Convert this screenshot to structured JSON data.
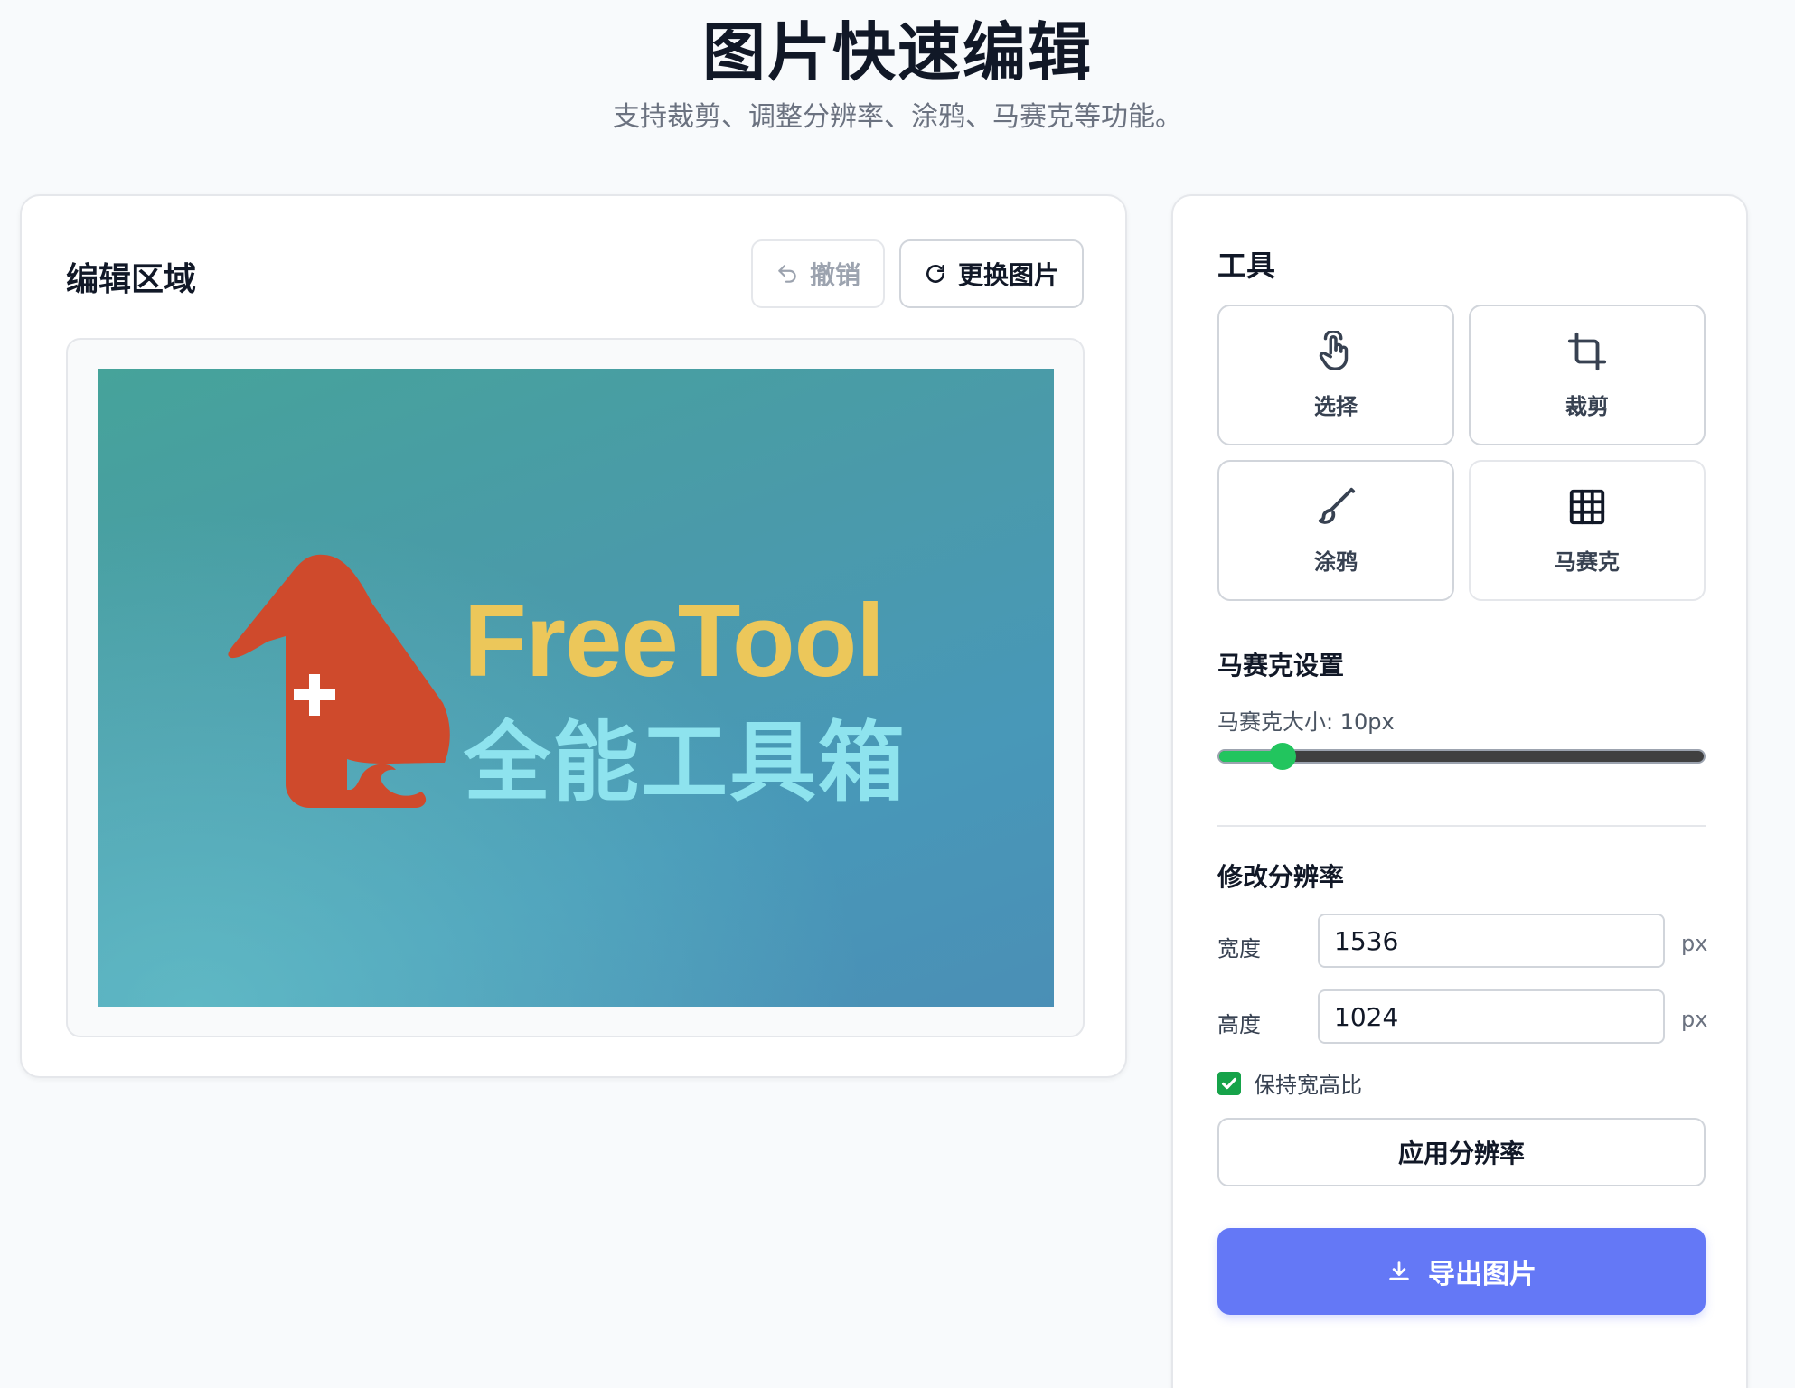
{
  "page": {
    "title": "图片快速编辑",
    "subtitle": "支持裁剪、调整分辨率、涂鸦、马赛克等功能。"
  },
  "editor": {
    "title": "编辑区域",
    "undo_label": "撤销",
    "undo_icon": "undo-icon",
    "replace_label": "更换图片",
    "replace_icon": "refresh-icon",
    "image": {
      "brand_en": "FreeTool",
      "brand_zh": "全能工具箱",
      "colors": {
        "bg_start": "#46a39a",
        "bg_end": "#4a8fb6",
        "logo_red": "#cf4a2c",
        "text_yellow": "#ecc75a",
        "text_cyan": "#8ee3ee"
      }
    }
  },
  "tools": {
    "title": "工具",
    "items": [
      {
        "label": "选择",
        "icon": "pointer-hand-icon"
      },
      {
        "label": "裁剪",
        "icon": "crop-icon"
      },
      {
        "label": "涂鸦",
        "icon": "brush-icon"
      },
      {
        "label": "马赛克",
        "icon": "grid-icon"
      }
    ],
    "active": "马赛克"
  },
  "mosaic": {
    "title": "马赛克设置",
    "size_text": "马赛克大小: 10px",
    "size_fraction": 0.13
  },
  "resolution": {
    "title": "修改分辨率",
    "width_label": "宽度",
    "width_value": "1536",
    "height_label": "高度",
    "height_value": "1024",
    "unit": "px",
    "keep_ratio_label": "保持宽高比",
    "keep_ratio_checked": true,
    "apply_label": "应用分辨率"
  },
  "export": {
    "label": "导出图片",
    "icon": "download-icon",
    "color": "#6478f6"
  },
  "theme": {
    "accent_green": "#22c55e"
  }
}
